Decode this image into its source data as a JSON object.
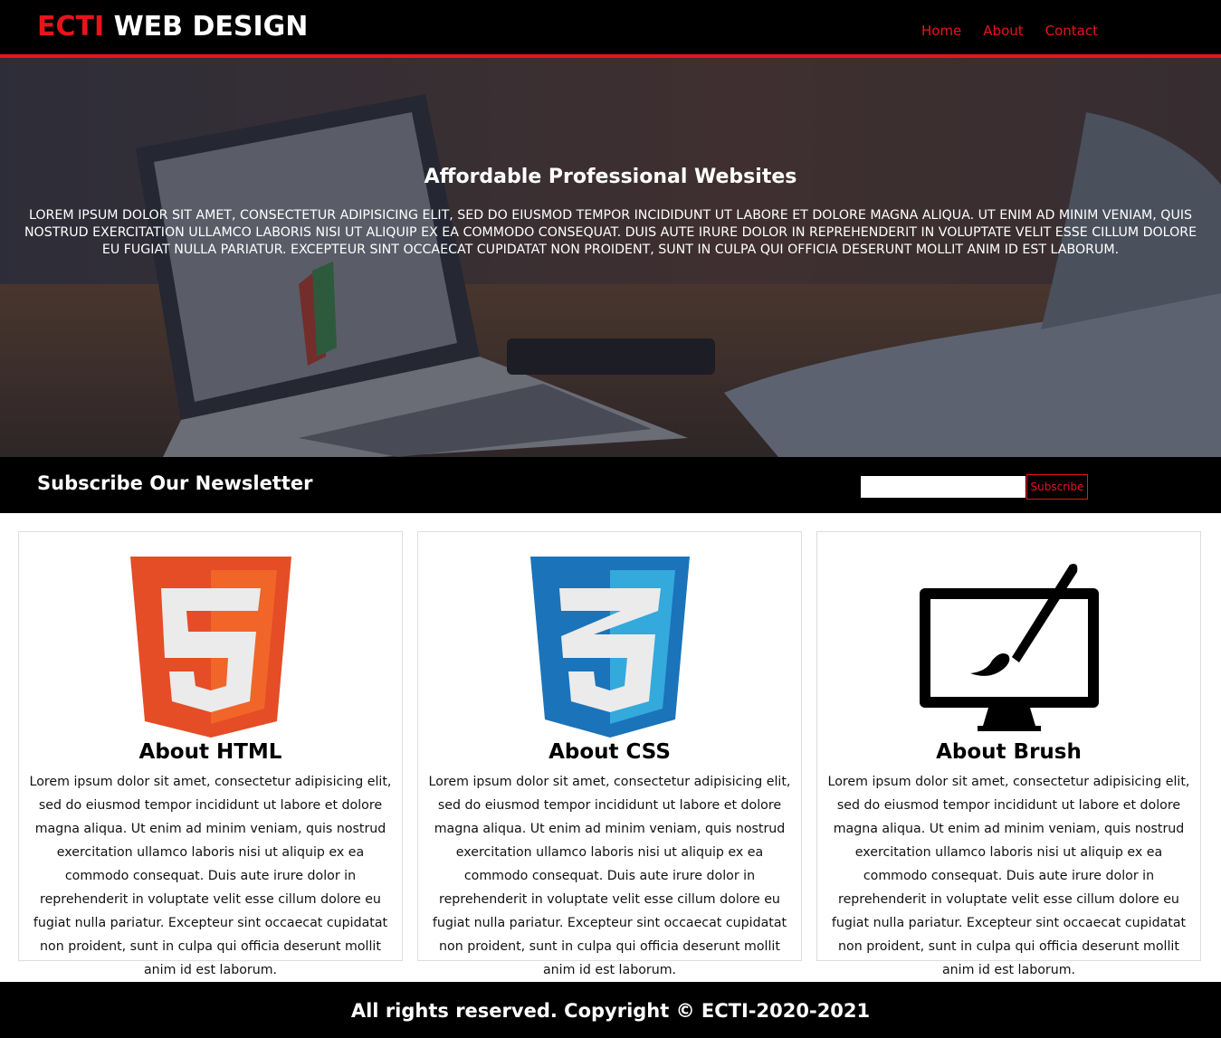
{
  "header": {
    "logo_highlight": "ECTI",
    "logo_rest": " WEB DESIGN",
    "nav": [
      "Home",
      "About",
      "Contact"
    ]
  },
  "hero": {
    "title": "Affordable Professional Websites",
    "text": "Lorem ipsum dolor sit amet, consectetur adipisicing elit, sed do eiusmod tempor incididunt ut labore et dolore magna aliqua. Ut enim ad minim veniam, quis nostrud exercitation ullamco laboris nisi ut aliquip ex ea commodo consequat. Duis aute irure dolor in reprehenderit in voluptate velit esse cillum dolore eu fugiat nulla pariatur. Excepteur sint occaecat cupidatat non proident, sunt in culpa qui officia deserunt mollit anim id est laborum."
  },
  "newsletter": {
    "title": "Subscribe Our Newsletter",
    "input_value": "",
    "button_label": "Subscribe"
  },
  "boxes": [
    {
      "icon": "html5-icon",
      "title": "About HTML",
      "text": "Lorem ipsum dolor sit amet, consectetur adipisicing elit, sed do eiusmod tempor incididunt ut labore et dolore magna aliqua. Ut enim ad minim veniam, quis nostrud exercitation ullamco laboris nisi ut aliquip ex ea commodo consequat. Duis aute irure dolor in reprehenderit in voluptate velit esse cillum dolore eu fugiat nulla pariatur. Excepteur sint occaecat cupidatat non proident, sunt in culpa qui officia deserunt mollit anim id est laborum."
    },
    {
      "icon": "css3-icon",
      "title": "About CSS",
      "text": "Lorem ipsum dolor sit amet, consectetur adipisicing elit, sed do eiusmod tempor incididunt ut labore et dolore magna aliqua. Ut enim ad minim veniam, quis nostrud exercitation ullamco laboris nisi ut aliquip ex ea commodo consequat. Duis aute irure dolor in reprehenderit in voluptate velit esse cillum dolore eu fugiat nulla pariatur. Excepteur sint occaecat cupidatat non proident, sunt in culpa qui officia deserunt mollit anim id est laborum."
    },
    {
      "icon": "monitor-brush-icon",
      "title": "About Brush",
      "text": "Lorem ipsum dolor sit amet, consectetur adipisicing elit, sed do eiusmod tempor incididunt ut labore et dolore magna aliqua. Ut enim ad minim veniam, quis nostrud exercitation ullamco laboris nisi ut aliquip ex ea commodo consequat. Duis aute irure dolor in reprehenderit in voluptate velit esse cillum dolore eu fugiat nulla pariatur. Excepteur sint occaecat cupidatat non proident, sunt in culpa qui officia deserunt mollit anim id est laborum."
    }
  ],
  "footer": {
    "text": "All rights reserved. Copyright © ECTI-2020-2021"
  },
  "colors": {
    "accent": "#e8141c",
    "header_bg": "#000000",
    "html5_orange": "#e44d26",
    "css3_blue": "#1b73ba"
  }
}
